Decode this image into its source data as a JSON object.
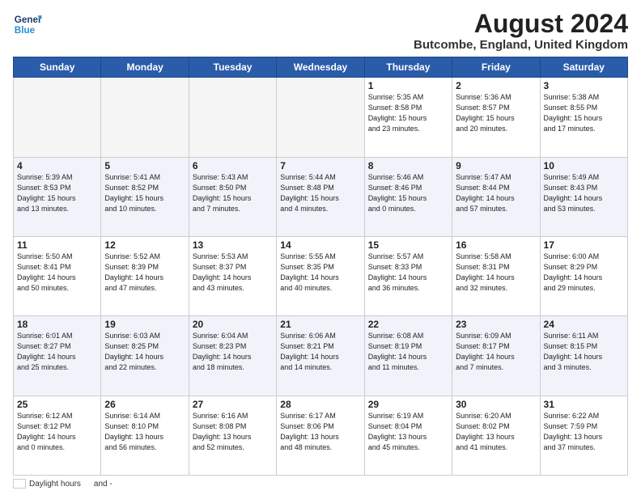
{
  "header": {
    "logo_line1": "General",
    "logo_line2": "Blue",
    "month_year": "August 2024",
    "location": "Butcombe, England, United Kingdom"
  },
  "weekdays": [
    "Sunday",
    "Monday",
    "Tuesday",
    "Wednesday",
    "Thursday",
    "Friday",
    "Saturday"
  ],
  "weeks": [
    [
      {
        "day": "",
        "info": "",
        "empty": true
      },
      {
        "day": "",
        "info": "",
        "empty": true
      },
      {
        "day": "",
        "info": "",
        "empty": true
      },
      {
        "day": "",
        "info": "",
        "empty": true
      },
      {
        "day": "1",
        "info": "Sunrise: 5:35 AM\nSunset: 8:58 PM\nDaylight: 15 hours\nand 23 minutes."
      },
      {
        "day": "2",
        "info": "Sunrise: 5:36 AM\nSunset: 8:57 PM\nDaylight: 15 hours\nand 20 minutes."
      },
      {
        "day": "3",
        "info": "Sunrise: 5:38 AM\nSunset: 8:55 PM\nDaylight: 15 hours\nand 17 minutes."
      }
    ],
    [
      {
        "day": "4",
        "info": "Sunrise: 5:39 AM\nSunset: 8:53 PM\nDaylight: 15 hours\nand 13 minutes."
      },
      {
        "day": "5",
        "info": "Sunrise: 5:41 AM\nSunset: 8:52 PM\nDaylight: 15 hours\nand 10 minutes."
      },
      {
        "day": "6",
        "info": "Sunrise: 5:43 AM\nSunset: 8:50 PM\nDaylight: 15 hours\nand 7 minutes."
      },
      {
        "day": "7",
        "info": "Sunrise: 5:44 AM\nSunset: 8:48 PM\nDaylight: 15 hours\nand 4 minutes."
      },
      {
        "day": "8",
        "info": "Sunrise: 5:46 AM\nSunset: 8:46 PM\nDaylight: 15 hours\nand 0 minutes."
      },
      {
        "day": "9",
        "info": "Sunrise: 5:47 AM\nSunset: 8:44 PM\nDaylight: 14 hours\nand 57 minutes."
      },
      {
        "day": "10",
        "info": "Sunrise: 5:49 AM\nSunset: 8:43 PM\nDaylight: 14 hours\nand 53 minutes."
      }
    ],
    [
      {
        "day": "11",
        "info": "Sunrise: 5:50 AM\nSunset: 8:41 PM\nDaylight: 14 hours\nand 50 minutes."
      },
      {
        "day": "12",
        "info": "Sunrise: 5:52 AM\nSunset: 8:39 PM\nDaylight: 14 hours\nand 47 minutes."
      },
      {
        "day": "13",
        "info": "Sunrise: 5:53 AM\nSunset: 8:37 PM\nDaylight: 14 hours\nand 43 minutes."
      },
      {
        "day": "14",
        "info": "Sunrise: 5:55 AM\nSunset: 8:35 PM\nDaylight: 14 hours\nand 40 minutes."
      },
      {
        "day": "15",
        "info": "Sunrise: 5:57 AM\nSunset: 8:33 PM\nDaylight: 14 hours\nand 36 minutes."
      },
      {
        "day": "16",
        "info": "Sunrise: 5:58 AM\nSunset: 8:31 PM\nDaylight: 14 hours\nand 32 minutes."
      },
      {
        "day": "17",
        "info": "Sunrise: 6:00 AM\nSunset: 8:29 PM\nDaylight: 14 hours\nand 29 minutes."
      }
    ],
    [
      {
        "day": "18",
        "info": "Sunrise: 6:01 AM\nSunset: 8:27 PM\nDaylight: 14 hours\nand 25 minutes."
      },
      {
        "day": "19",
        "info": "Sunrise: 6:03 AM\nSunset: 8:25 PM\nDaylight: 14 hours\nand 22 minutes."
      },
      {
        "day": "20",
        "info": "Sunrise: 6:04 AM\nSunset: 8:23 PM\nDaylight: 14 hours\nand 18 minutes."
      },
      {
        "day": "21",
        "info": "Sunrise: 6:06 AM\nSunset: 8:21 PM\nDaylight: 14 hours\nand 14 minutes."
      },
      {
        "day": "22",
        "info": "Sunrise: 6:08 AM\nSunset: 8:19 PM\nDaylight: 14 hours\nand 11 minutes."
      },
      {
        "day": "23",
        "info": "Sunrise: 6:09 AM\nSunset: 8:17 PM\nDaylight: 14 hours\nand 7 minutes."
      },
      {
        "day": "24",
        "info": "Sunrise: 6:11 AM\nSunset: 8:15 PM\nDaylight: 14 hours\nand 3 minutes."
      }
    ],
    [
      {
        "day": "25",
        "info": "Sunrise: 6:12 AM\nSunset: 8:12 PM\nDaylight: 14 hours\nand 0 minutes."
      },
      {
        "day": "26",
        "info": "Sunrise: 6:14 AM\nSunset: 8:10 PM\nDaylight: 13 hours\nand 56 minutes."
      },
      {
        "day": "27",
        "info": "Sunrise: 6:16 AM\nSunset: 8:08 PM\nDaylight: 13 hours\nand 52 minutes."
      },
      {
        "day": "28",
        "info": "Sunrise: 6:17 AM\nSunset: 8:06 PM\nDaylight: 13 hours\nand 48 minutes."
      },
      {
        "day": "29",
        "info": "Sunrise: 6:19 AM\nSunset: 8:04 PM\nDaylight: 13 hours\nand 45 minutes."
      },
      {
        "day": "30",
        "info": "Sunrise: 6:20 AM\nSunset: 8:02 PM\nDaylight: 13 hours\nand 41 minutes."
      },
      {
        "day": "31",
        "info": "Sunrise: 6:22 AM\nSunset: 7:59 PM\nDaylight: 13 hours\nand 37 minutes."
      }
    ]
  ],
  "footer": {
    "daylight_label": "Daylight hours",
    "and_dash": "and -"
  }
}
